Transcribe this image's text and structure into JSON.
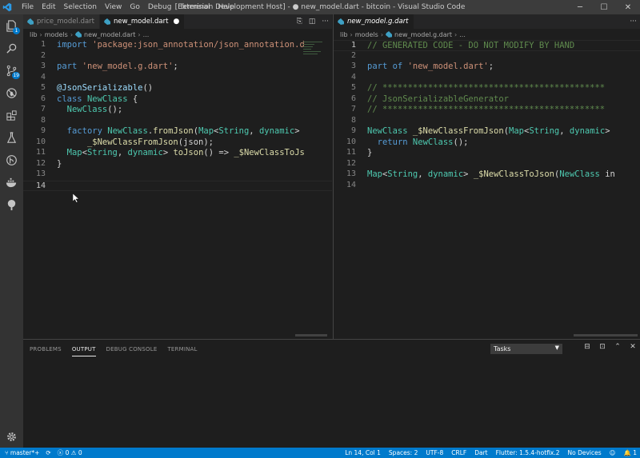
{
  "titlebar": {
    "menu": [
      "File",
      "Edit",
      "Selection",
      "View",
      "Go",
      "Debug",
      "Terminal",
      "Help"
    ],
    "title": "[Extension Development Host] - ● new_model.dart - bitcoin - Visual Studio Code"
  },
  "activitybar": {
    "explorer_badge": "1",
    "scm_badge": "19"
  },
  "left_editor": {
    "tabs": [
      {
        "label": "price_model.dart",
        "active": false
      },
      {
        "label": "new_model.dart",
        "active": true,
        "dirty": "●"
      }
    ],
    "breadcrumb": [
      "lib",
      "models",
      "new_model.dart",
      "..."
    ],
    "lines": [
      {
        "n": "1",
        "text": "import 'package:json_annotation/json_annotation.d"
      },
      {
        "n": "2",
        "text": ""
      },
      {
        "n": "3",
        "text": "part 'new_model.g.dart';"
      },
      {
        "n": "4",
        "text": ""
      },
      {
        "n": "5",
        "text": "@JsonSerializable()"
      },
      {
        "n": "6",
        "text": "class NewClass {"
      },
      {
        "n": "7",
        "text": "  NewClass();"
      },
      {
        "n": "8",
        "text": ""
      },
      {
        "n": "9",
        "text": "  factory NewClass.fromJson(Map<String, dynamic>"
      },
      {
        "n": "10",
        "text": "      _$NewClassFromJson(json);"
      },
      {
        "n": "11",
        "text": "  Map<String, dynamic> toJson() => _$NewClassToJs"
      },
      {
        "n": "12",
        "text": "}"
      },
      {
        "n": "13",
        "text": ""
      },
      {
        "n": "14",
        "text": ""
      }
    ]
  },
  "right_editor": {
    "tabs": [
      {
        "label": "new_model.g.dart",
        "active": true,
        "italic": true
      }
    ],
    "breadcrumb": [
      "lib",
      "models",
      "new_model.g.dart",
      "..."
    ],
    "lines": [
      {
        "n": "1",
        "text": "// GENERATED CODE - DO NOT MODIFY BY HAND"
      },
      {
        "n": "2",
        "text": ""
      },
      {
        "n": "3",
        "text": "part of 'new_model.dart';"
      },
      {
        "n": "4",
        "text": ""
      },
      {
        "n": "5",
        "text": "// ********************************************"
      },
      {
        "n": "6",
        "text": "// JsonSerializableGenerator"
      },
      {
        "n": "7",
        "text": "// ********************************************"
      },
      {
        "n": "8",
        "text": ""
      },
      {
        "n": "9",
        "text": "NewClass _$NewClassFromJson(Map<String, dynamic>"
      },
      {
        "n": "10",
        "text": "  return NewClass();"
      },
      {
        "n": "11",
        "text": "}"
      },
      {
        "n": "12",
        "text": ""
      },
      {
        "n": "13",
        "text": "Map<String, dynamic> _$NewClassToJson(NewClass in"
      },
      {
        "n": "14",
        "text": ""
      }
    ]
  },
  "panel": {
    "tabs": [
      "PROBLEMS",
      "OUTPUT",
      "DEBUG CONSOLE",
      "TERMINAL"
    ],
    "active_tab": "OUTPUT",
    "select_value": "Tasks"
  },
  "statusbar": {
    "branch": "master*+",
    "errors": "0",
    "warnings": "0",
    "position": "Ln 14, Col 1",
    "spaces": "Spaces: 2",
    "encoding": "UTF-8",
    "eol": "CRLF",
    "language": "Dart",
    "flutter": "Flutter: 1.5.4-hotfix.2",
    "devices": "No Devices",
    "notifications": "1"
  },
  "colors": {
    "accent": "#007acc",
    "keyword": "#569cd6",
    "string": "#ce9178",
    "class": "#4ec9b0",
    "function": "#dcdcaa",
    "comment": "#608b4e"
  }
}
